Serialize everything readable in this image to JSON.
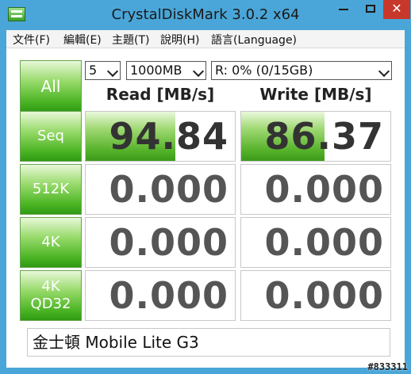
{
  "window": {
    "title": "CrystalDiskMark 3.0.2 x64",
    "accent_color": "#4aa6d8",
    "close_color": "#c7382b",
    "min_glyph": "",
    "max_glyph": "",
    "close_glyph": "✕"
  },
  "menu": {
    "items": [
      {
        "label": "文件(F)"
      },
      {
        "label": "編輯(E)"
      },
      {
        "label": "主題(T)"
      },
      {
        "label": "說明(H)"
      },
      {
        "label": "語言(Language)"
      }
    ]
  },
  "controls": {
    "all_label": "All",
    "runs_value": "5",
    "size_value": "1000MB",
    "drive_value": "R: 0% (0/15GB)"
  },
  "columns": {
    "read_header": "Read [MB/s]",
    "write_header": "Write [MB/s]"
  },
  "rows": [
    {
      "label": "Seq",
      "label_lines": [
        "Seq"
      ],
      "read": "94.84",
      "write": "86.37",
      "read_fill_fraction": 0.6,
      "write_fill_fraction": 0.56
    },
    {
      "label": "512K",
      "label_lines": [
        "512K"
      ],
      "read": "0.000",
      "write": "0.000",
      "read_fill_fraction": 0,
      "write_fill_fraction": 0
    },
    {
      "label": "4K",
      "label_lines": [
        "4K"
      ],
      "read": "0.000",
      "write": "0.000",
      "read_fill_fraction": 0,
      "write_fill_fraction": 0
    },
    {
      "label": "4K QD32",
      "label_lines": [
        "4K",
        "QD32"
      ],
      "read": "0.000",
      "write": "0.000",
      "read_fill_fraction": 0,
      "write_fill_fraction": 0
    }
  ],
  "comment": "金士頓 Mobile Lite G3",
  "watermark": "#833311"
}
